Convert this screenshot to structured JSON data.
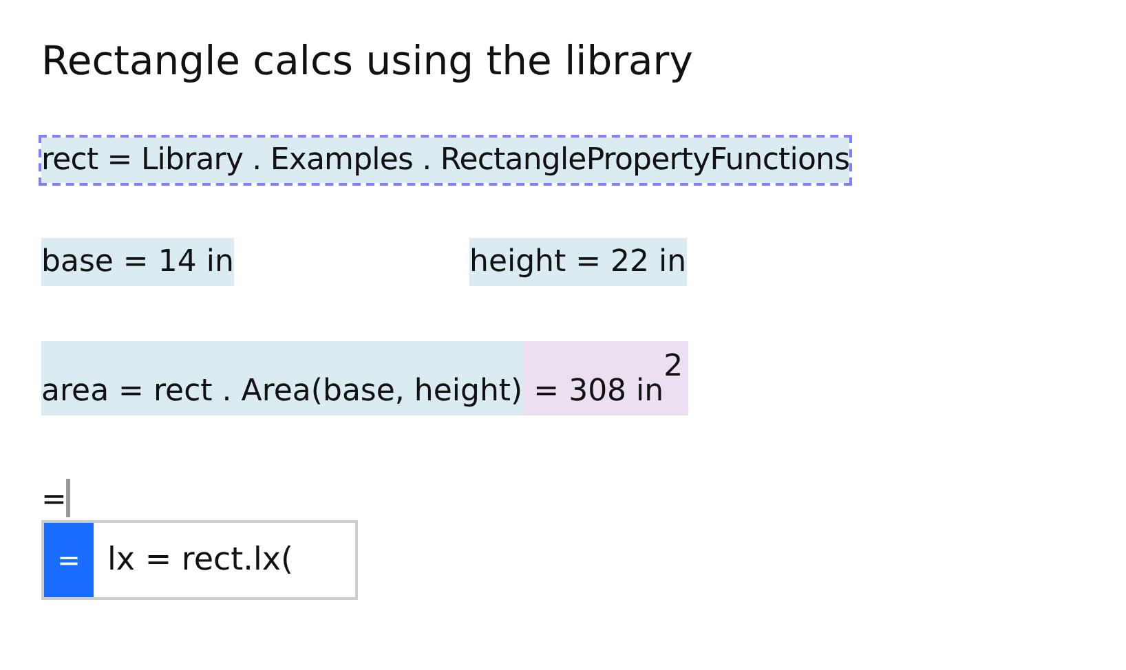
{
  "title": "Rectangle calcs using the library",
  "definition": {
    "text": "rect = Library . Examples . RectanglePropertyFunctions",
    "selected": true
  },
  "variables": [
    {
      "text": "base = 14 in"
    },
    {
      "text": "height = 22 in"
    }
  ],
  "calculation": {
    "expression": "area = rect . Area(base, height)",
    "result": "= 308 in$^{2}$"
  },
  "input": {
    "value": "="
  },
  "autocomplete": {
    "items": [
      {
        "symbol": "=",
        "text": "lx = rect.lx(",
        "selected": true
      }
    ]
  }
}
